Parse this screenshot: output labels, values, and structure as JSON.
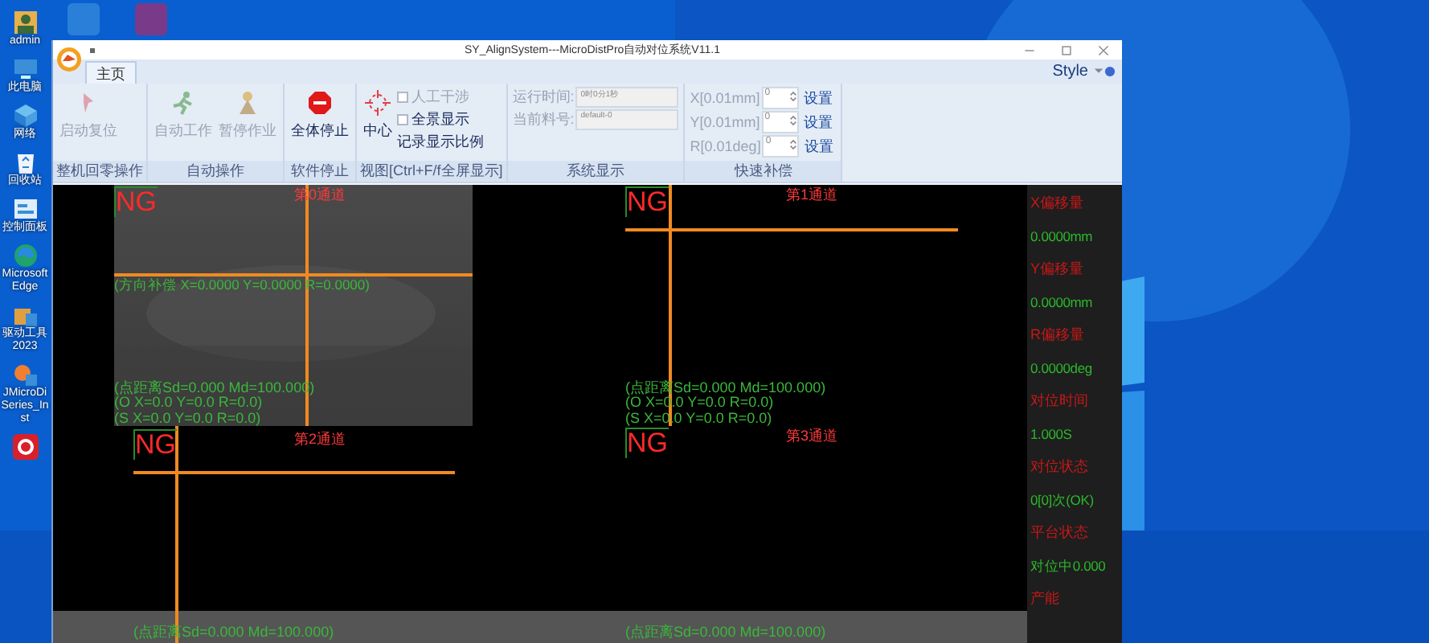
{
  "desktop": {
    "icons": [
      {
        "label": "admin",
        "kind": "user"
      },
      {
        "label": "此电脑",
        "kind": "computer"
      },
      {
        "label": "网络",
        "kind": "network"
      },
      {
        "label": "回收站",
        "kind": "recycle"
      },
      {
        "label": "控制面板",
        "kind": "panel"
      },
      {
        "label": "Microsoft Edge",
        "kind": "edge"
      },
      {
        "label": "驱动工具 2023",
        "kind": "box"
      },
      {
        "label": "JMicroDi Series_Inst",
        "kind": "installer"
      },
      {
        "kind": "red"
      }
    ],
    "top_icons": [
      {
        "kind": "app"
      },
      {
        "kind": "archive"
      }
    ]
  },
  "window": {
    "title": "SY_AlignSystem---MicroDistPro自动对位系统V11.1",
    "tabs": [
      {
        "label": "主页",
        "selected": true
      }
    ],
    "style_menu": "Style",
    "groups": [
      {
        "label": "整机回零操作",
        "buttons": [
          {
            "label": "启动复位",
            "kind": "pin",
            "disabled": true
          }
        ]
      },
      {
        "label": "自动操作",
        "buttons": [
          {
            "label": "自动工作",
            "kind": "run",
            "disabled": true
          },
          {
            "label": "暂停作业",
            "kind": "person",
            "disabled": true
          }
        ]
      },
      {
        "label": "软件停止",
        "buttons": [
          {
            "label": "全体停止",
            "kind": "stop",
            "disabled": false
          }
        ]
      },
      {
        "label": "视图[Ctrl+F/f全屏显示]",
        "buttons": [
          {
            "label": "中心",
            "kind": "target",
            "disabled": false
          }
        ],
        "options": [
          {
            "label": "人工干涉",
            "checked": false,
            "disabled": true
          },
          {
            "label": "全景显示",
            "checked": false,
            "disabled": false
          }
        ],
        "link": "记录显示比例"
      },
      {
        "label": "系统显示",
        "fields": [
          {
            "label": "运行时间:",
            "value": "0时0分1秒"
          },
          {
            "label": "当前料号:",
            "value": "default-0"
          }
        ]
      },
      {
        "label": "快速补偿",
        "spinners": [
          {
            "label": "X[0.01mm]",
            "value": "0",
            "action": "设置"
          },
          {
            "label": "Y[0.01mm]",
            "value": "0",
            "action": "设置"
          },
          {
            "label": "R[0.01deg]",
            "value": "0",
            "action": "设置"
          }
        ]
      }
    ],
    "views": [
      {
        "channel": "第0通道",
        "status": "NG",
        "has_image": true,
        "compensation": "(方向补偿 X=0.0000 Y=0.0000 R=0.0000)",
        "lines": [
          "(点距离Sd=0.000 Md=100.000)",
          "(O X=0.0 Y=0.0 R=0.0)",
          "(S X=0.0 Y=0.0 R=0.0)"
        ]
      },
      {
        "channel": "第1通道",
        "status": "NG",
        "has_image": false,
        "lines": [
          "(点距离Sd=0.000 Md=100.000)",
          "(O X=0.0 Y=0.0 R=0.0)",
          "(S X=0.0 Y=0.0 R=0.0)"
        ]
      },
      {
        "channel": "第2通道",
        "status": "NG",
        "has_image": false,
        "lines": [
          "(点距离Sd=0.000 Md=100.000)"
        ]
      },
      {
        "channel": "第3通道",
        "status": "NG",
        "has_image": false,
        "lines": [
          "(点距离Sd=0.000 Md=100.000)"
        ]
      }
    ],
    "info_panel": [
      {
        "kind": "label",
        "text": "X偏移量"
      },
      {
        "kind": "value",
        "text": "0.0000mm"
      },
      {
        "kind": "label",
        "text": "Y偏移量"
      },
      {
        "kind": "value",
        "text": "0.0000mm"
      },
      {
        "kind": "label",
        "text": "R偏移量"
      },
      {
        "kind": "value",
        "text": "0.0000deg"
      },
      {
        "kind": "label",
        "text": "对位时间"
      },
      {
        "kind": "value",
        "text": "1.000S"
      },
      {
        "kind": "label",
        "text": "对位状态"
      },
      {
        "kind": "value",
        "text": "0[0]次(OK)"
      },
      {
        "kind": "label",
        "text": "平台状态"
      },
      {
        "kind": "value",
        "text": "对位中0.000"
      },
      {
        "kind": "label",
        "text": "产能"
      }
    ]
  }
}
